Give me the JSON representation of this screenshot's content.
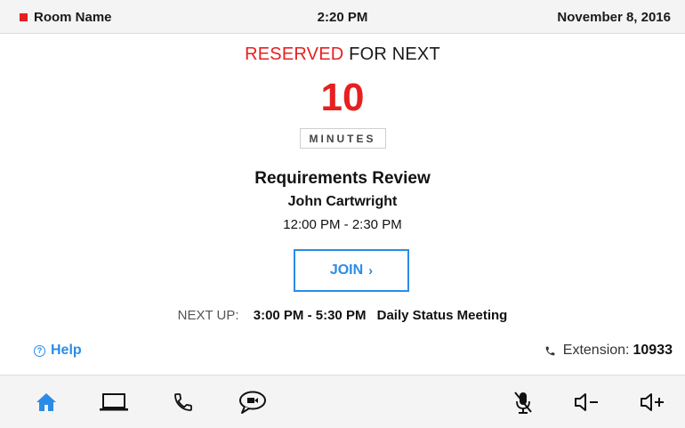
{
  "header": {
    "room_name": "Room Name",
    "time": "2:20 PM",
    "date": "November 8, 2016"
  },
  "status": {
    "reserved_word": "RESERVED",
    "reserved_rest": "FOR NEXT",
    "countdown": "10",
    "unit": "MINUTES"
  },
  "meeting": {
    "title": "Requirements Review",
    "organizer": "John Cartwright",
    "time_range": "12:00 PM - 2:30 PM",
    "join_label": "JOIN",
    "join_chevron": "›"
  },
  "next_up": {
    "label": "NEXT UP:",
    "time_range": "3:00 PM - 5:30 PM",
    "title": "Daily Status Meeting"
  },
  "footer": {
    "help_label": "Help",
    "help_icon_glyph": "?",
    "extension_label": "Extension:",
    "extension_number": "10933"
  },
  "toolbar": {
    "items": [
      "home-icon",
      "laptop-icon",
      "phone-icon",
      "chat-video-icon",
      "mic-muted-icon",
      "volume-down-icon",
      "volume-up-icon"
    ]
  },
  "colors": {
    "accent_red": "#e62020",
    "accent_blue": "#2a8ce8",
    "bar_bg": "#f4f4f5"
  }
}
